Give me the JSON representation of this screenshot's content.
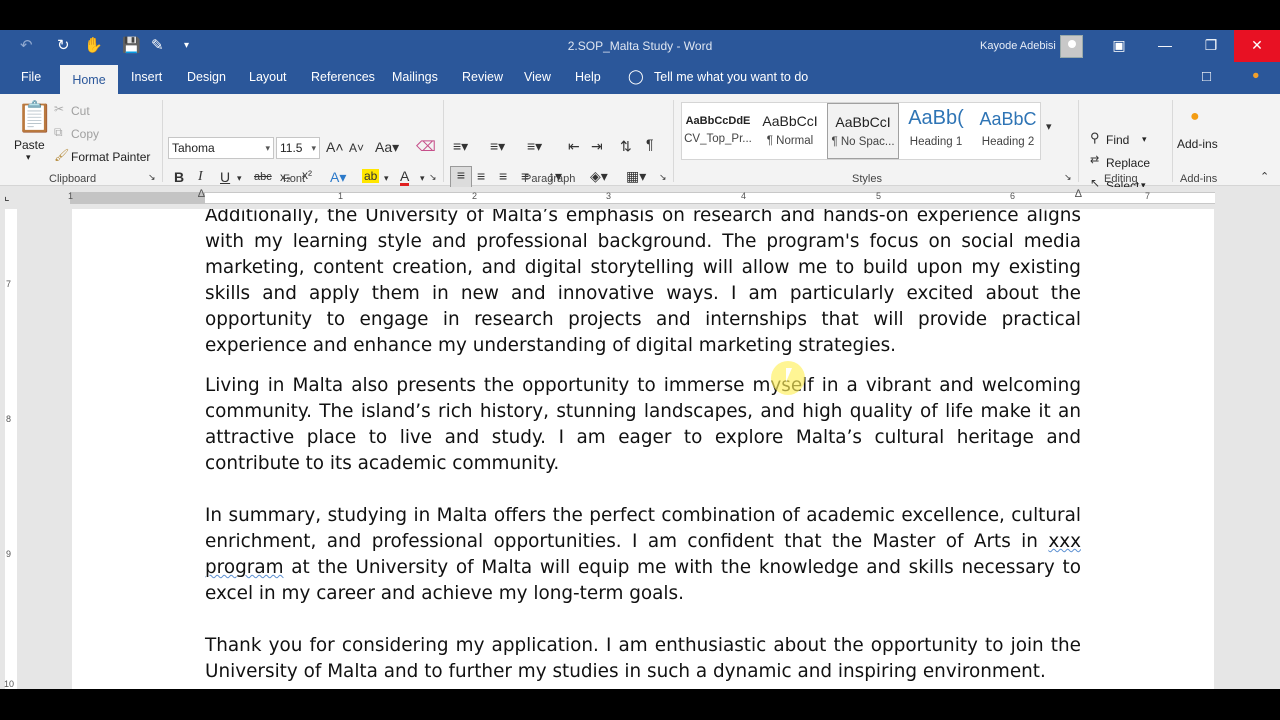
{
  "titlebar": {
    "title": "2.SOP_Malta Study  -  Word",
    "user": "Kayode Adebisi"
  },
  "tabs": [
    "File",
    "Home",
    "Insert",
    "Design",
    "Layout",
    "References",
    "Mailings",
    "Review",
    "View",
    "Help"
  ],
  "tell_me": "Tell me what you want to do",
  "clipboard": {
    "paste": "Paste",
    "cut": "Cut",
    "copy": "Copy",
    "format_painter": "Format Painter",
    "label": "Clipboard"
  },
  "font": {
    "name": "Tahoma",
    "size": "11.5",
    "label": "Font",
    "bold": "B",
    "italic": "I",
    "underline": "U"
  },
  "paragraph": {
    "label": "Paragraph"
  },
  "styles": {
    "label": "Styles",
    "items": [
      {
        "preview": "AaBbCcDdE",
        "name": "CV_Top_Pr..."
      },
      {
        "preview": "AaBbCcI",
        "name": "¶ Normal"
      },
      {
        "preview": "AaBbCcI",
        "name": "¶ No Spac..."
      },
      {
        "preview": "AaBb(",
        "name": "Heading 1"
      },
      {
        "preview": "AaBbC",
        "name": "Heading 2"
      }
    ]
  },
  "editing": {
    "find": "Find",
    "replace": "Replace",
    "select": "Select",
    "label": "Editing"
  },
  "addins": {
    "button": "Add-ins",
    "label": "Add-ins"
  },
  "ruler_numbers": [
    "1",
    "1",
    "2",
    "3",
    "4",
    "5",
    "6",
    "7"
  ],
  "vruler_numbers": [
    "7",
    "8",
    "9",
    "10"
  ],
  "document": {
    "p1": "Additionally, the University of Malta’s emphasis on research and hands-on experience aligns with my learning style and professional background. The program's focus on social media marketing, content creation, and digital storytelling will allow me to build upon my existing skills and apply them in new and innovative ways. I am particularly excited about the opportunity to engage in research projects and internships that will provide practical experience and enhance my understanding of digital marketing strategies.",
    "p2": "Living in Malta also presents the opportunity to immerse myself in a vibrant and welcoming community. The island’s rich history, stunning landscapes, and high quality of life make it an attractive place to live and study. I am eager to explore Malta’s cultural heritage and contribute to its academic community.",
    "p3_before": "In summary, studying in Malta offers the perfect combination of academic excellence, cultural enrichment, and professional opportunities. I am confident that the Master of Arts in ",
    "p3_squig1": "xxx",
    "p3_space": " ",
    "p3_squig2": "program",
    "p3_after": " at the University of Malta will equip me with the knowledge and skills necessary to excel in my career and achieve my long-term goals.",
    "p4": "Thank you for considering my application. I am enthusiastic about the opportunity to join the University of Malta and to further my studies in such a dynamic and inspiring environment."
  }
}
